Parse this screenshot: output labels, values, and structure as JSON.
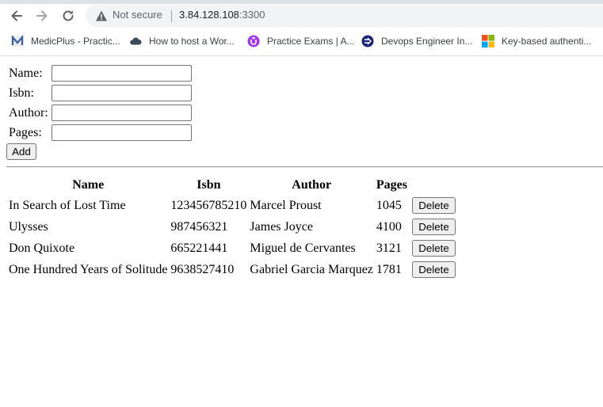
{
  "browser": {
    "security_label": "Not secure",
    "url_host": "3.84.128.108",
    "url_port": ":3300",
    "bookmarks": [
      {
        "label": "MedicPlus - Practic...",
        "icon": "medicplus-m-icon"
      },
      {
        "label": "How to host a Wor...",
        "icon": "cloud-icon"
      },
      {
        "label": "Practice Exams | A...",
        "icon": "udemy-icon"
      },
      {
        "label": "Devops Engineer In...",
        "icon": "arrow-circle-icon"
      },
      {
        "label": "Key-based authenti...",
        "icon": "microsoft-logo-icon"
      }
    ]
  },
  "form": {
    "name_label": "Name:",
    "isbn_label": "Isbn:",
    "author_label": "Author:",
    "pages_label": "Pages:",
    "name_value": "",
    "isbn_value": "",
    "author_value": "",
    "pages_value": "",
    "add_label": "Add"
  },
  "table": {
    "headers": [
      "Name",
      "Isbn",
      "Author",
      "Pages"
    ],
    "delete_label": "Delete",
    "rows": [
      {
        "name": "In Search of Lost Time",
        "isbn": "123456785210",
        "author": "Marcel Proust",
        "pages": "1045"
      },
      {
        "name": "Ulysses",
        "isbn": "987456321",
        "author": "James Joyce",
        "pages": "4100"
      },
      {
        "name": "Don Quixote",
        "isbn": "665221441",
        "author": "Miguel de Cervantes",
        "pages": "3121"
      },
      {
        "name": "One Hundred Years of Solitude",
        "isbn": "9638527410",
        "author": "Gabriel Garcia Marquez",
        "pages": "1781"
      }
    ]
  },
  "colors": {
    "udemy": "#a435f0",
    "devops": "#1a237e",
    "medicplus": "#3b5ba5"
  }
}
